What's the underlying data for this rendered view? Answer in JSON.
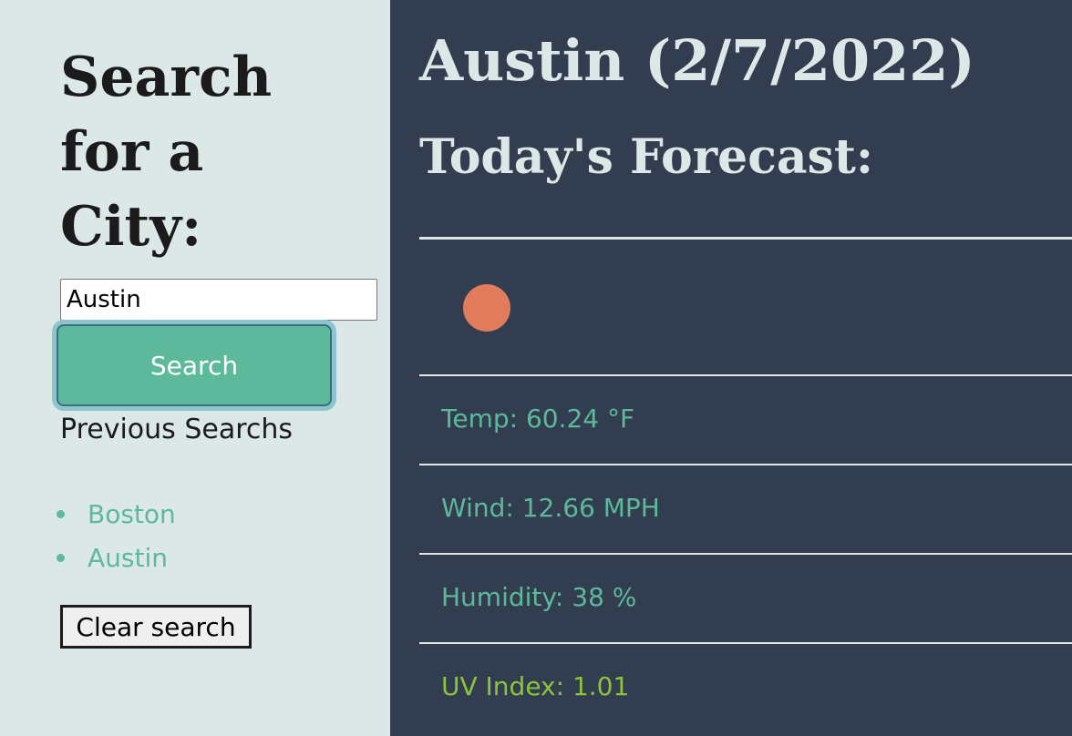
{
  "sidebar": {
    "title": "Search for a City:",
    "search_input_value": "Austin",
    "search_button_label": "Search",
    "previous_label": "Previous Searchs",
    "history": [
      "Boston",
      "Austin"
    ],
    "clear_button_label": "Clear search"
  },
  "main": {
    "city_title": "Austin (2/7/2022)",
    "forecast_heading": "Today's Forecast:",
    "weather_icon": "sun-icon",
    "temp": "Temp: 60.24 °F",
    "wind": "Wind: 12.66 MPH",
    "humidity": "Humidity: 38 %",
    "uv_index": "UV Index: 1.01"
  },
  "colors": {
    "sidebar_bg": "#dce7e8",
    "main_bg": "#323d4f",
    "accent": "#5cb99b",
    "uv_low": "#8cc43c",
    "icon_orange": "#e07b5b"
  }
}
